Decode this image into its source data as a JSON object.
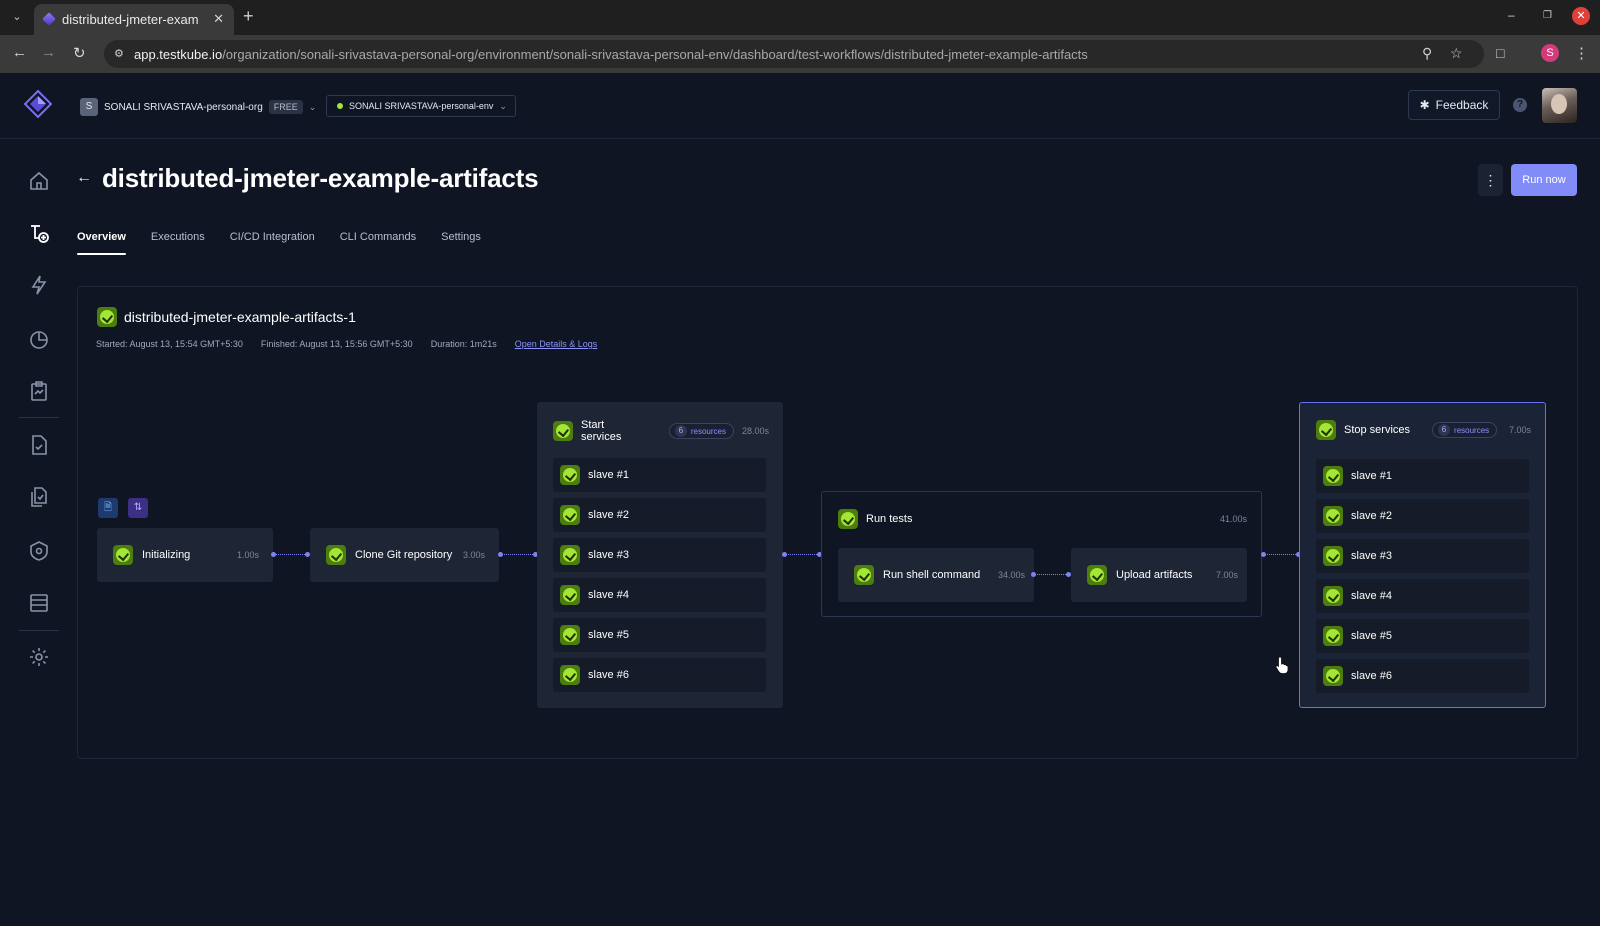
{
  "browser": {
    "tab_title": "distributed-jmeter-exam",
    "url_host": "app.testkube.io",
    "url_path": "/organization/sonali-srivastava-personal-org/environment/sonali-srivastava-personal-env/dashboard/test-workflows/distributed-jmeter-example-artifacts",
    "profile_initial": "S"
  },
  "header": {
    "org_initial": "S",
    "org_name": "SONALI SRIVASTAVA-personal-org",
    "plan": "FREE",
    "env_name": "SONALI SRIVASTAVA-personal-env",
    "feedback_label": "Feedback"
  },
  "page": {
    "title": "distributed-jmeter-example-artifacts",
    "run_label": "Run now",
    "tabs": [
      "Overview",
      "Executions",
      "CI/CD Integration",
      "CLI Commands",
      "Settings"
    ],
    "active_tab": "Overview"
  },
  "execution": {
    "name": "distributed-jmeter-example-artifacts-1",
    "started": "Started: August 13, 15:54 GMT+5:30",
    "finished": "Finished: August 13, 15:56 GMT+5:30",
    "duration": "Duration: 1m21s",
    "details_link": "Open Details & Logs"
  },
  "pipeline": {
    "initializing": {
      "label": "Initializing",
      "duration": "1.00s"
    },
    "clone": {
      "label": "Clone Git repository",
      "duration": "3.00s"
    },
    "start_services": {
      "label": "Start services",
      "resources_count": "6",
      "resources_label": "resources",
      "duration": "28.00s",
      "items": [
        "slave #1",
        "slave #2",
        "slave #3",
        "slave #4",
        "slave #5",
        "slave #6"
      ]
    },
    "run_tests": {
      "label": "Run tests",
      "duration": "41.00s",
      "shell": {
        "label": "Run shell command",
        "duration": "34.00s"
      },
      "upload": {
        "label": "Upload artifacts",
        "duration": "7.00s"
      }
    },
    "stop_services": {
      "label": "Stop services",
      "resources_count": "6",
      "resources_label": "resources",
      "duration": "7.00s",
      "items": [
        "slave #1",
        "slave #2",
        "slave #3",
        "slave #4",
        "slave #5",
        "slave #6"
      ]
    }
  },
  "colors": {
    "background": "#0f1523",
    "accent": "#818cf8",
    "success": "#a3e635",
    "node": "#1e2535"
  }
}
